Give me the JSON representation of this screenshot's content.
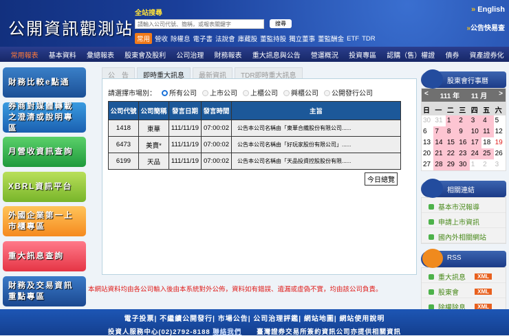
{
  "header": {
    "logo": "公開資訊觀測站",
    "search_label": "全站搜尋",
    "search_placeholder": "請輸入公司代號、簡稱，或報表關鍵字",
    "search_button": "搜尋",
    "quick_tag": "常用",
    "quick_links": [
      "營收",
      "除權息",
      "電子書",
      "法說會",
      "庫藏股",
      "董監持股",
      "獨立董事",
      "董監酬金",
      "ETF",
      "TDR"
    ],
    "english": "English",
    "quick_query": "公告快易查"
  },
  "nav": [
    "常用報表",
    "基本資料",
    "彙總報表",
    "股東會及股利",
    "公司治理",
    "財務報表",
    "重大訊息與公告",
    "營運概況",
    "投資專區",
    "認購（售）權證",
    "債券",
    "資產證券化"
  ],
  "banners": [
    "財務比較e點通",
    "券商對媒體轉載之澄清或說明專區",
    "月營收資訊查詢",
    "XBRL資訊平台",
    "外國企業第一上市櫃專區",
    "重大訊息查詢",
    "財務及交易資訊重點專區"
  ],
  "tabs": [
    "公　告",
    "即時重大訊息",
    "最新資訊",
    "TDR即時重大訊息"
  ],
  "market": {
    "label": "請選擇市場別：",
    "options": [
      "所有公司",
      "上市公司",
      "上櫃公司",
      "興櫃公司",
      "公開發行公司"
    ]
  },
  "table": {
    "headers": [
      "公司代號",
      "公司簡稱",
      "發言日期",
      "發言時間",
      "主旨"
    ],
    "rows": [
      [
        "1418",
        "東華",
        "111/11/19",
        "07:00:02",
        "公告本公司名稱由「東華合纖股份有限公司......"
      ],
      [
        "6473",
        "美賣*",
        "111/11/19",
        "07:00:02",
        "公告本公司名稱由「好玩家股份有限公司」......"
      ],
      [
        "6199",
        "天品",
        "111/11/19",
        "07:00:02",
        "公告本公司名稱由「天品投資控股股份有限......"
      ]
    ]
  },
  "today_button": "今日總覽",
  "disclaimer": "本網站資料均由各公司輸入後由本系統對外公佈，資料如有錯誤、遺漏或虛偽不實，均由該公司負責。",
  "calendar": {
    "title": "股東會行事曆",
    "prev": "<",
    "next": ">",
    "year": "111 年",
    "month": "11 月",
    "weekdays": [
      "日",
      "一",
      "二",
      "三",
      "四",
      "五",
      "六"
    ]
  },
  "links": {
    "title": "相關連結",
    "items": [
      "基本市況報導",
      "申請上市資訊",
      "國內外相關網站"
    ]
  },
  "rss": {
    "title": "RSS",
    "items": [
      "重大訊息",
      "股東會",
      "除權除息"
    ],
    "badge": "XML"
  },
  "footer": {
    "links": [
      "電子投票",
      "不繼續公開發行",
      "市場公告",
      "公司治理評鑑",
      "網站地圖",
      "網站使用說明"
    ],
    "service": "投資人服務中心(02)2792-8188",
    "contact": "聯絡我們",
    "note": "臺灣證券交易所簽約資訊公司亦提供相關資訊"
  }
}
